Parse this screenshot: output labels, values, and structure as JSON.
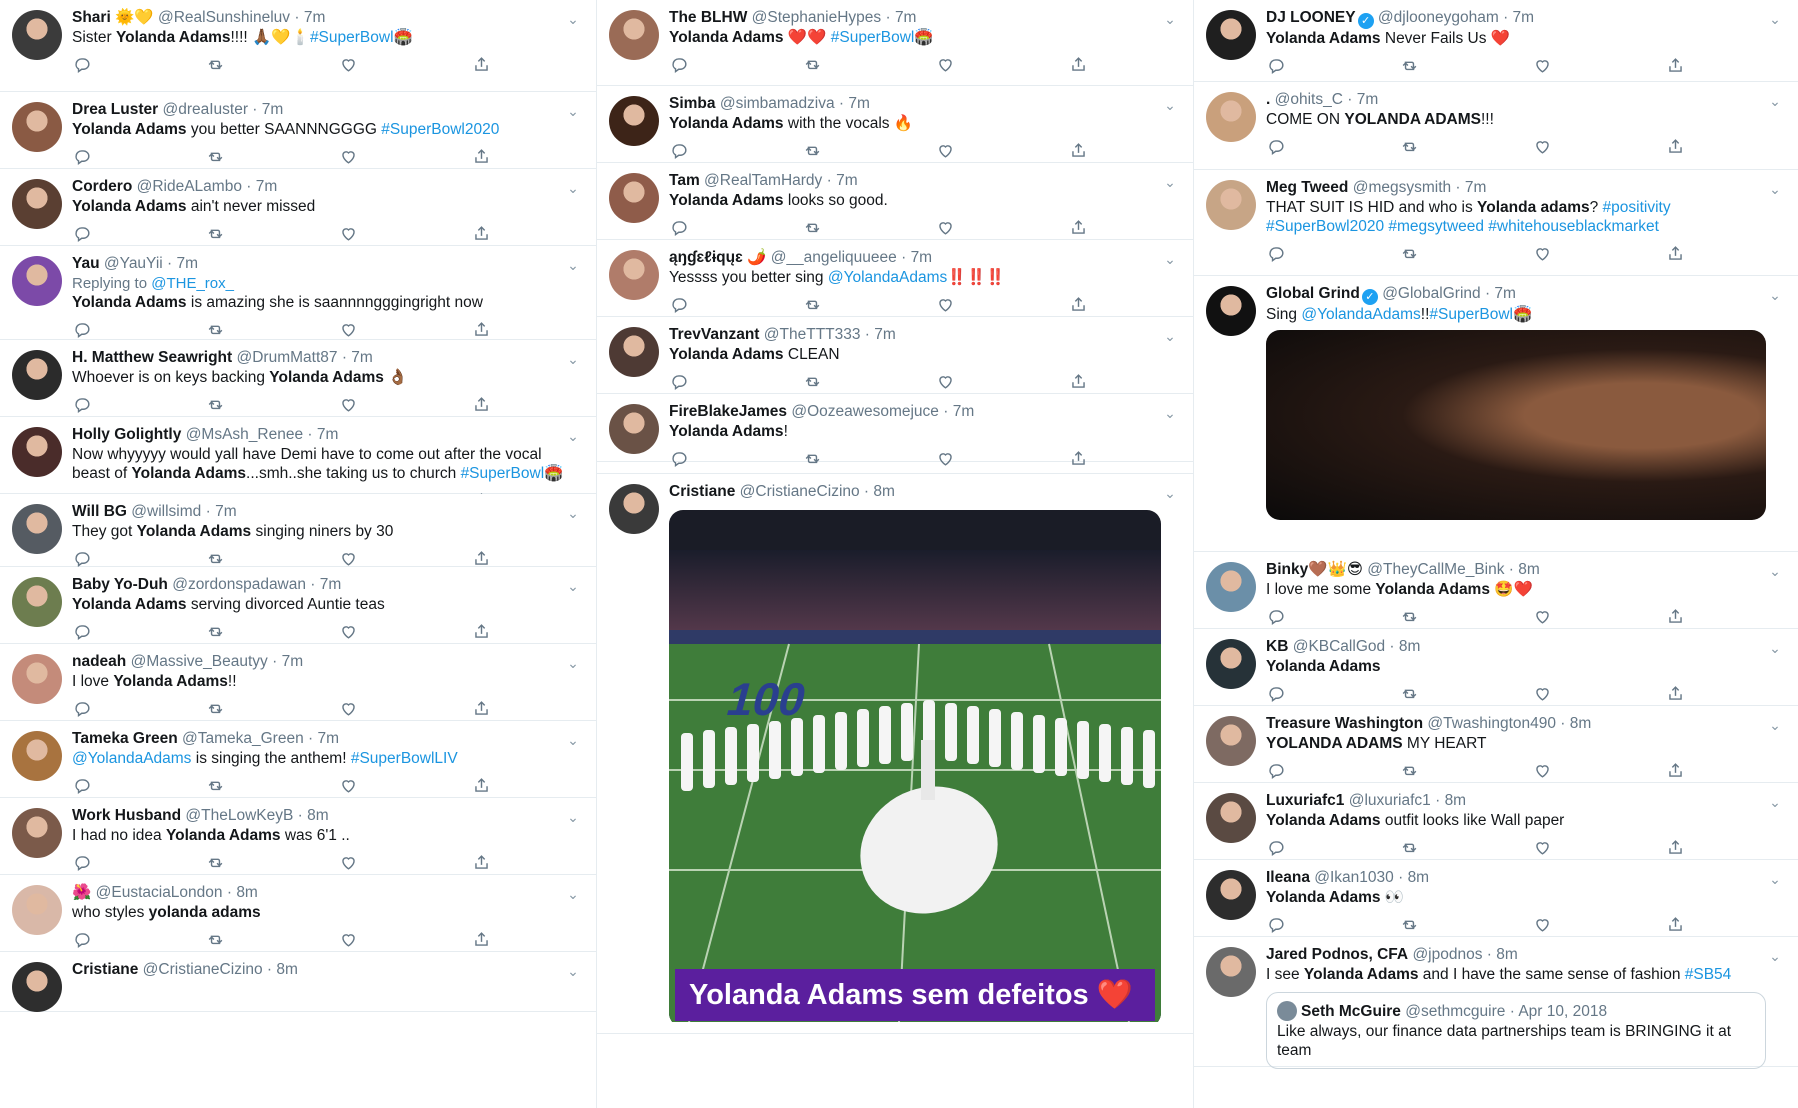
{
  "col1": [
    {
      "name": "Shari 🌞💛",
      "handle": "@RealSunshineluv",
      "time": "7m",
      "pre": "Sister ",
      "bold": "Yolanda Adams",
      "post": "!!!! 🙏🏾💛🕯️",
      "tag": "#SuperBowl🏟️"
    },
    {
      "name": "Drea Luster",
      "handle": "@dreaIuster",
      "time": "7m",
      "bold": "Yolanda Adams",
      "post": " you better SAANNNGGGG ",
      "tag": "#SuperBowl2020"
    },
    {
      "name": "Cordero",
      "handle": "@RideALambo",
      "time": "7m",
      "bold": "Yolanda Adams",
      "post": " ain't never missed"
    },
    {
      "name": "Yau",
      "handle": "@YauYii",
      "time": "7m",
      "reply_prefix": "Replying to ",
      "reply_to": "@THE_rox_",
      "bold": "Yolanda Adams",
      "post": " is amazing she is saannnngggingright now"
    },
    {
      "name": "H. Matthew Seawright",
      "handle": "@DrumMatt87",
      "time": "7m",
      "pre": "Whoever is on keys backing ",
      "bold": "Yolanda Adams",
      "post": " 👌🏾"
    },
    {
      "name": "Holly Golightly",
      "handle": "@MsAsh_Renee",
      "time": "7m",
      "pre": "Now whyyyyy would yall have Demi have to come out after the vocal beast of ",
      "bold": "Yolanda Adams",
      "post": "...smh..she taking us to church  ",
      "tag": "#SuperBowl🏟️"
    },
    {
      "name": "Will BG",
      "handle": "@willsimd",
      "time": "7m",
      "pre": "They got ",
      "bold": "Yolanda Adams",
      "post": " singing niners by 30"
    },
    {
      "name": "Baby Yo-Duh",
      "handle": "@zordonspadawan",
      "time": "7m",
      "bold": "Yolanda Adams",
      "post": " serving divorced Auntie teas"
    },
    {
      "name": "nadeah",
      "handle": "@Massive_Beautyy",
      "time": "7m",
      "pre": "I love ",
      "bold": "Yolanda Adams",
      "post": "!!"
    },
    {
      "name": "Tameka Green",
      "handle": "@Tameka_Green",
      "time": "7m",
      "mention": "@YolandaAdams",
      "post": " is singing the anthem! ",
      "tag": "#SuperBowlLIV"
    },
    {
      "name": "Work Husband",
      "handle": "@TheLowKeyB",
      "time": "8m",
      "pre": "I had no idea ",
      "bold": "Yolanda Adams",
      "post": " was 6'1 .."
    },
    {
      "name": "🌺",
      "handle": "@EustaciaLondon",
      "time": "8m",
      "pre": "who styles ",
      "bold": "yolanda adams",
      "post": ""
    },
    {
      "name": "Cristiane",
      "handle": "@CristianeCizino",
      "time": "8m",
      "pre": "",
      "bold": "",
      "post": ""
    }
  ],
  "col2": [
    {
      "name": "The BLHW",
      "handle": "@StephanieHypes",
      "time": "7m",
      "bold": "Yolanda Adams",
      "post": " ❤️❤️ ",
      "tag": "#SuperBowl🏟️"
    },
    {
      "name": "Simba",
      "handle": "@simbamadziva",
      "time": "7m",
      "bold": "Yolanda Adams",
      "post": " with the vocals 🔥"
    },
    {
      "name": "Tam",
      "handle": "@RealTamHardy",
      "time": "7m",
      "bold": "Yolanda Adams",
      "post": " looks so good."
    },
    {
      "name": "ąŋɠɛℓɨqųɛ 🌶️",
      "handle": "@__angeliquueee",
      "time": "7m",
      "pre": "Yessss you better sing ",
      "mention": "@YolandaAdams",
      "post": "‼️‼️‼️"
    },
    {
      "name": "TrevVanzant",
      "handle": "@TheTTT333",
      "time": "7m",
      "bold": "Yolanda Adams",
      "post": " CLEAN"
    },
    {
      "name": "FireBlakeJames",
      "handle": "@Oozeawesomejuce",
      "time": "7m",
      "bold": "Yolanda Adams",
      "post": "!"
    }
  ],
  "col2_media_tweet": {
    "name": "Cristiane",
    "handle": "@CristianeCizino",
    "time": "8m",
    "caption": "Yolanda Adams sem defeitos ❤️"
  },
  "col3": [
    {
      "name": "DJ LOONEY",
      "verified": true,
      "handle": "@djlooneygoham",
      "time": "7m",
      "bold": "Yolanda Adams",
      "post": " Never Fails Us ❤️"
    },
    {
      "name": ".",
      "handle": "@ohits_C",
      "time": "7m",
      "pre": "COME ON ",
      "bold": "YOLANDA ADAMS",
      "post": "!!!"
    },
    {
      "name": "Meg Tweed",
      "handle": "@megsysmith",
      "time": "7m",
      "pre": "THAT SUIT IS HID and who is ",
      "bold": "Yolanda adams",
      "post": "?  ",
      "tag": "#positivity #SuperBowl2020 #megsytweed #whitehouseblackmarket"
    }
  ],
  "col3_media_tweet": {
    "name": "Global Grind",
    "verified": true,
    "handle": "@GlobalGrind",
    "time": "7m",
    "pre": "Sing ",
    "mention": "@YolandaAdams",
    "post": "!!",
    "tag": "#SuperBowl🏟️"
  },
  "col3b": [
    {
      "name": "Binky🤎👑😎",
      "handle": "@TheyCallMe_Bink",
      "time": "8m",
      "pre": "I love me some ",
      "bold": "Yolanda Adams",
      "post": " 🤩❤️"
    },
    {
      "name": "KB",
      "handle": "@KBCallGod",
      "time": "8m",
      "bold": "Yolanda Adams",
      "post": ""
    },
    {
      "name": "Treasure Washington",
      "handle": "@Twashington490",
      "time": "8m",
      "bold": "YOLANDA ADAMS",
      "post": " MY HEART"
    },
    {
      "name": "Luxuriafc1",
      "handle": "@luxuriafc1",
      "time": "8m",
      "bold": "Yolanda Adams",
      "post": " outfit looks like Wall paper"
    },
    {
      "name": "Ileana",
      "handle": "@Ikan1030",
      "time": "8m",
      "bold": "Yolanda Adams",
      "post": " 👀"
    }
  ],
  "col3_quote_tweet": {
    "name": "Jared Podnos, CFA",
    "handle": "@jpodnos",
    "time": "8m",
    "pre": "I see ",
    "bold": "Yolanda Adams",
    "post": " and I have the same sense of fashion ",
    "tag": "#SB54",
    "quote": {
      "name": "Seth McGuire",
      "handle": "@sethmcguire",
      "date": "Apr 10, 2018",
      "text": "Like always, our finance data partnerships team is BRINGING it at team"
    }
  },
  "ui": {
    "chevron": "⌄",
    "dot": " · ",
    "check": "✓"
  },
  "avatar_colors": [
    "#3b3b3b",
    "#8a5a44",
    "#5a3f32",
    "#7c4aa8",
    "#2b2b2b",
    "#4a2c2a",
    "#555b62",
    "#6d7d4f",
    "#c48b7a",
    "#a8733f",
    "#7b5a4a",
    "#d9b8a8",
    "#2e2e2e",
    "#9a6b56",
    "#3d2418",
    "#8f5c4a",
    "#b07c6a",
    "#4e3a34",
    "#6a5246",
    "#3a3a3a",
    "#1f1f1f",
    "#c9a07c",
    "#c7a586",
    "#111111",
    "#6b8fa8",
    "#263238",
    "#7e6a62",
    "#5a4a42",
    "#2d2d2d",
    "#6a6a6a"
  ],
  "colors": {
    "link": "#1b95e0",
    "heart": "#e0245e",
    "caption_bg": "#5b1f9e",
    "field_green": "#3b7a3a"
  }
}
